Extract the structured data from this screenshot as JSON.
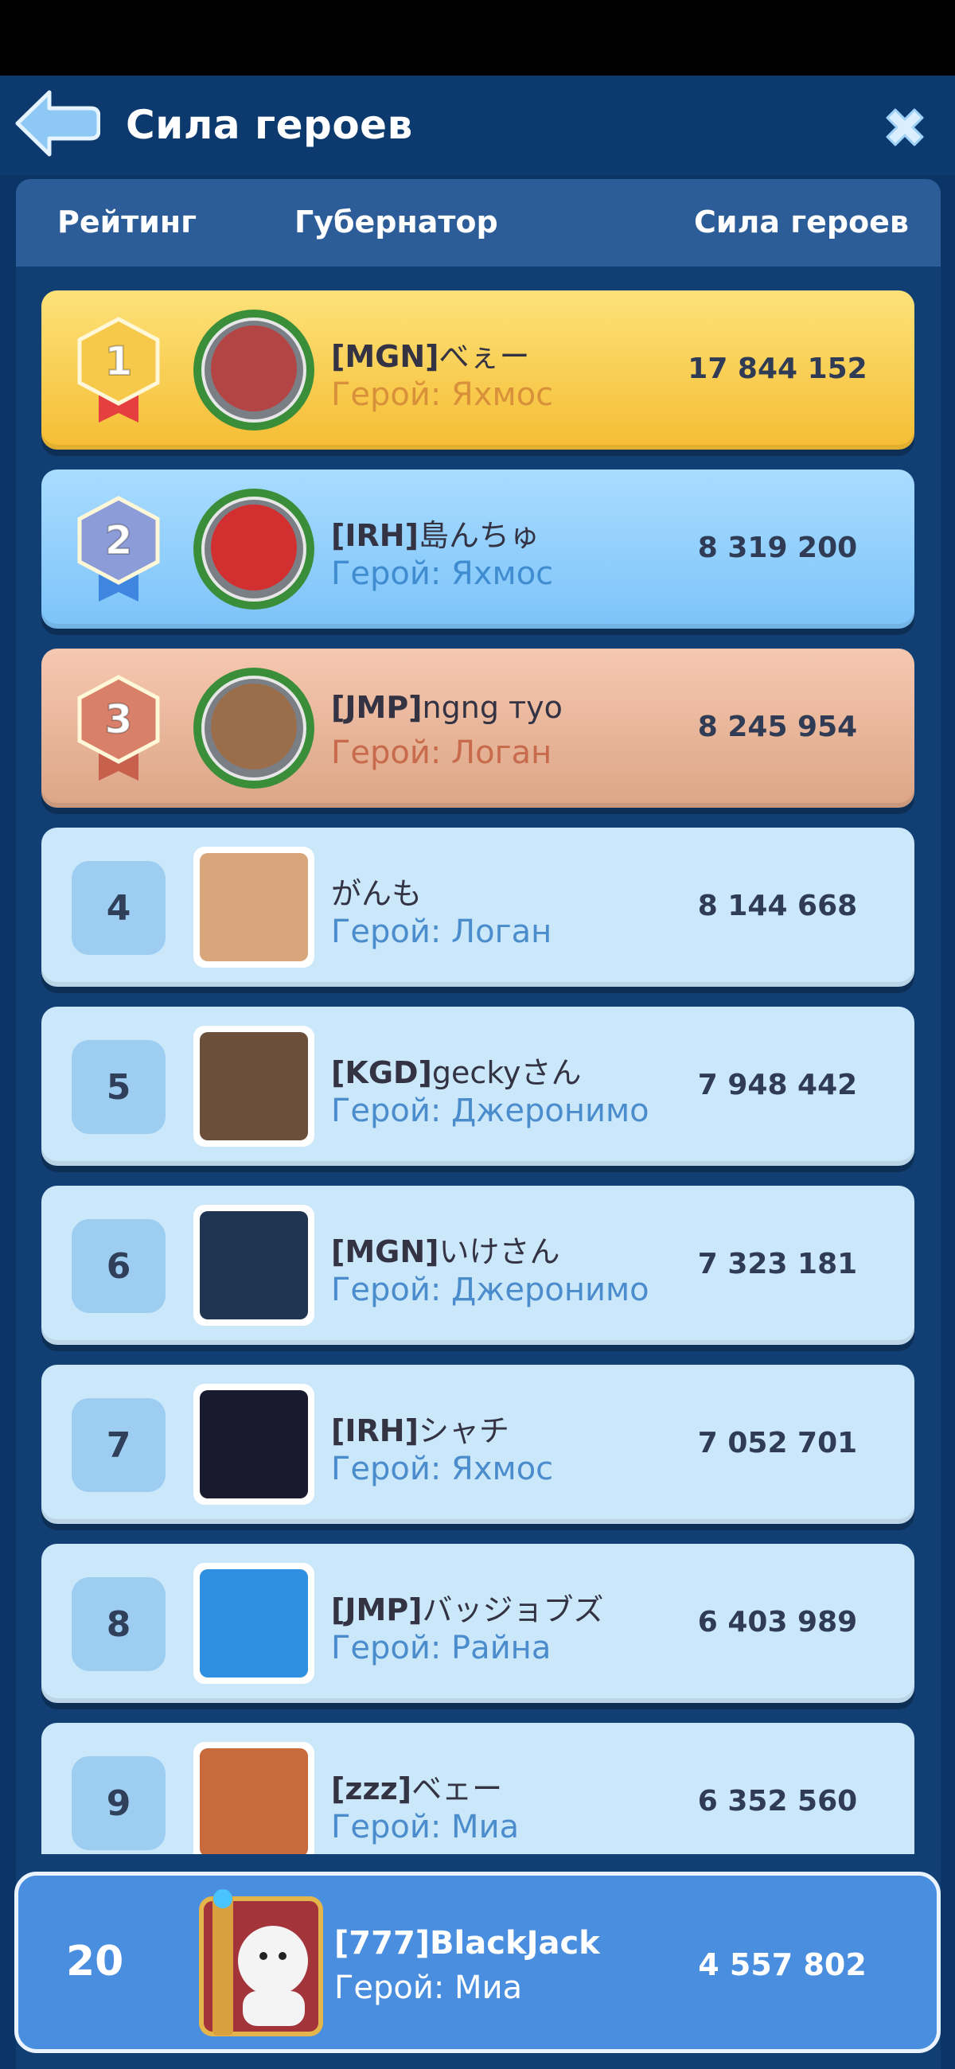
{
  "window": {
    "title": "Сила героев"
  },
  "columns": {
    "rank": "Рейтинг",
    "governor": "Губернатор",
    "power": "Сила героев"
  },
  "rows": [
    {
      "rank": "1",
      "tag": "[MGN]",
      "name": "べぇー",
      "hero": "Герой: Яхмос",
      "power": "17 844 152",
      "style": "gold"
    },
    {
      "rank": "2",
      "tag": "[IRH]",
      "name": "島んちゅ",
      "hero": "Герой: Яхмос",
      "power": "8 319 200",
      "style": "silver"
    },
    {
      "rank": "3",
      "tag": "[JMP]",
      "name": "ngng тyo",
      "hero": "Герой: Логан",
      "power": "8 245 954",
      "style": "bronze"
    },
    {
      "rank": "4",
      "tag": "",
      "name": "がんも",
      "hero": "Герой: Логан",
      "power": "8 144 668",
      "style": "plain"
    },
    {
      "rank": "5",
      "tag": "[KGD]",
      "name": "geckyさん",
      "hero": "Герой: Джеронимо",
      "power": "7 948 442",
      "style": "plain"
    },
    {
      "rank": "6",
      "tag": "[MGN]",
      "name": "いけさん",
      "hero": "Герой: Джеронимо",
      "power": "7 323 181",
      "style": "plain"
    },
    {
      "rank": "7",
      "tag": "[IRH]",
      "name": "シャチ",
      "hero": "Герой: Яхмос",
      "power": "7 052 701",
      "style": "plain"
    },
    {
      "rank": "8",
      "tag": "[JMP]",
      "name": "バッジョブズ",
      "hero": "Герой: Райна",
      "power": "6 403 989",
      "style": "plain"
    },
    {
      "rank": "9",
      "tag": "[zzz]",
      "name": "ベェー",
      "hero": "Герой: Миа",
      "power": "6 352 560",
      "style": "plain"
    }
  ],
  "me": {
    "rank": "20",
    "name": "[777]BlackJack",
    "hero": "Герой: Миа",
    "power": "4 557 802"
  },
  "colors": {
    "background": "#0b3566",
    "gold": "#f5bd33",
    "silver": "#7cc3f9",
    "bronze": "#dca586",
    "plain": "#cbe8fb",
    "me": "#4a8ee0"
  },
  "icons": {
    "back": "back-arrow-icon",
    "close": "close-icon",
    "medal": "rank-medal-icon"
  }
}
